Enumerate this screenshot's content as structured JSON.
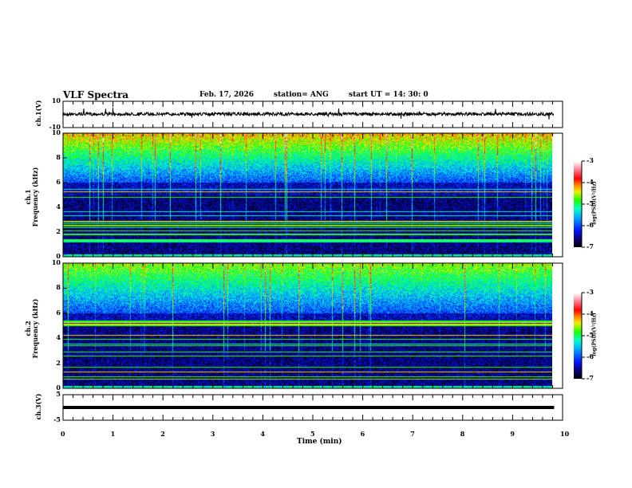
{
  "header": {
    "title": "VLF Spectra",
    "date": "Feb. 17, 2026",
    "station": "station= ANG",
    "start": "start  UT =   14: 30: 0"
  },
  "chart_data": [
    {
      "type": "line",
      "ylabel": "ch.1(V)",
      "ylim": [
        -10,
        10
      ],
      "yticks": [
        "10",
        "-10"
      ],
      "xlim": [
        0,
        10
      ],
      "data_end_min": 9.83,
      "description_level": 0
    },
    {
      "type": "heatmap",
      "ylabel": "ch.1\nFrequency (kHz)",
      "ylim": [
        0,
        10
      ],
      "yticks": [
        "0",
        "2",
        "4",
        "6",
        "8",
        "10"
      ],
      "xlim": [
        0,
        10
      ],
      "colorbar": {
        "label": "log(PSD)(V²/Hz)",
        "range": [
          -7,
          -3
        ],
        "ticks": [
          "-3",
          "-4",
          "-5",
          "-6",
          "-7"
        ]
      }
    },
    {
      "type": "heatmap",
      "ylabel": "ch.2\nFrequency (kHz)",
      "ylim": [
        0,
        10
      ],
      "yticks": [
        "0",
        "2",
        "4",
        "6",
        "8",
        "10"
      ],
      "xlim": [
        0,
        10
      ],
      "colorbar": {
        "label": "log(PSD)(V²/Hz)",
        "range": [
          -7,
          -3
        ],
        "ticks": [
          "-3",
          "-4",
          "-5",
          "-6",
          "-7"
        ]
      }
    },
    {
      "type": "line",
      "ylabel": "ch.3(V)",
      "ylim": [
        -5,
        5
      ],
      "yticks": [
        "5",
        "-5"
      ],
      "xlim": [
        0,
        10
      ],
      "level": 0.5
    }
  ],
  "xaxis": {
    "label": "Time (min)",
    "ticks": [
      "0",
      "1",
      "2",
      "3",
      "4",
      "5",
      "6",
      "7",
      "8",
      "9",
      "10"
    ]
  },
  "labels": {
    "ch1": "ch.1(V)",
    "sp1a": "ch.1",
    "sp1b": "Frequency (kHz)",
    "sp2a": "ch.2",
    "sp2b": "Frequency (kHz)",
    "ch3": "ch.3(V)",
    "cb": "log(PSD)(V²/Hz)"
  }
}
